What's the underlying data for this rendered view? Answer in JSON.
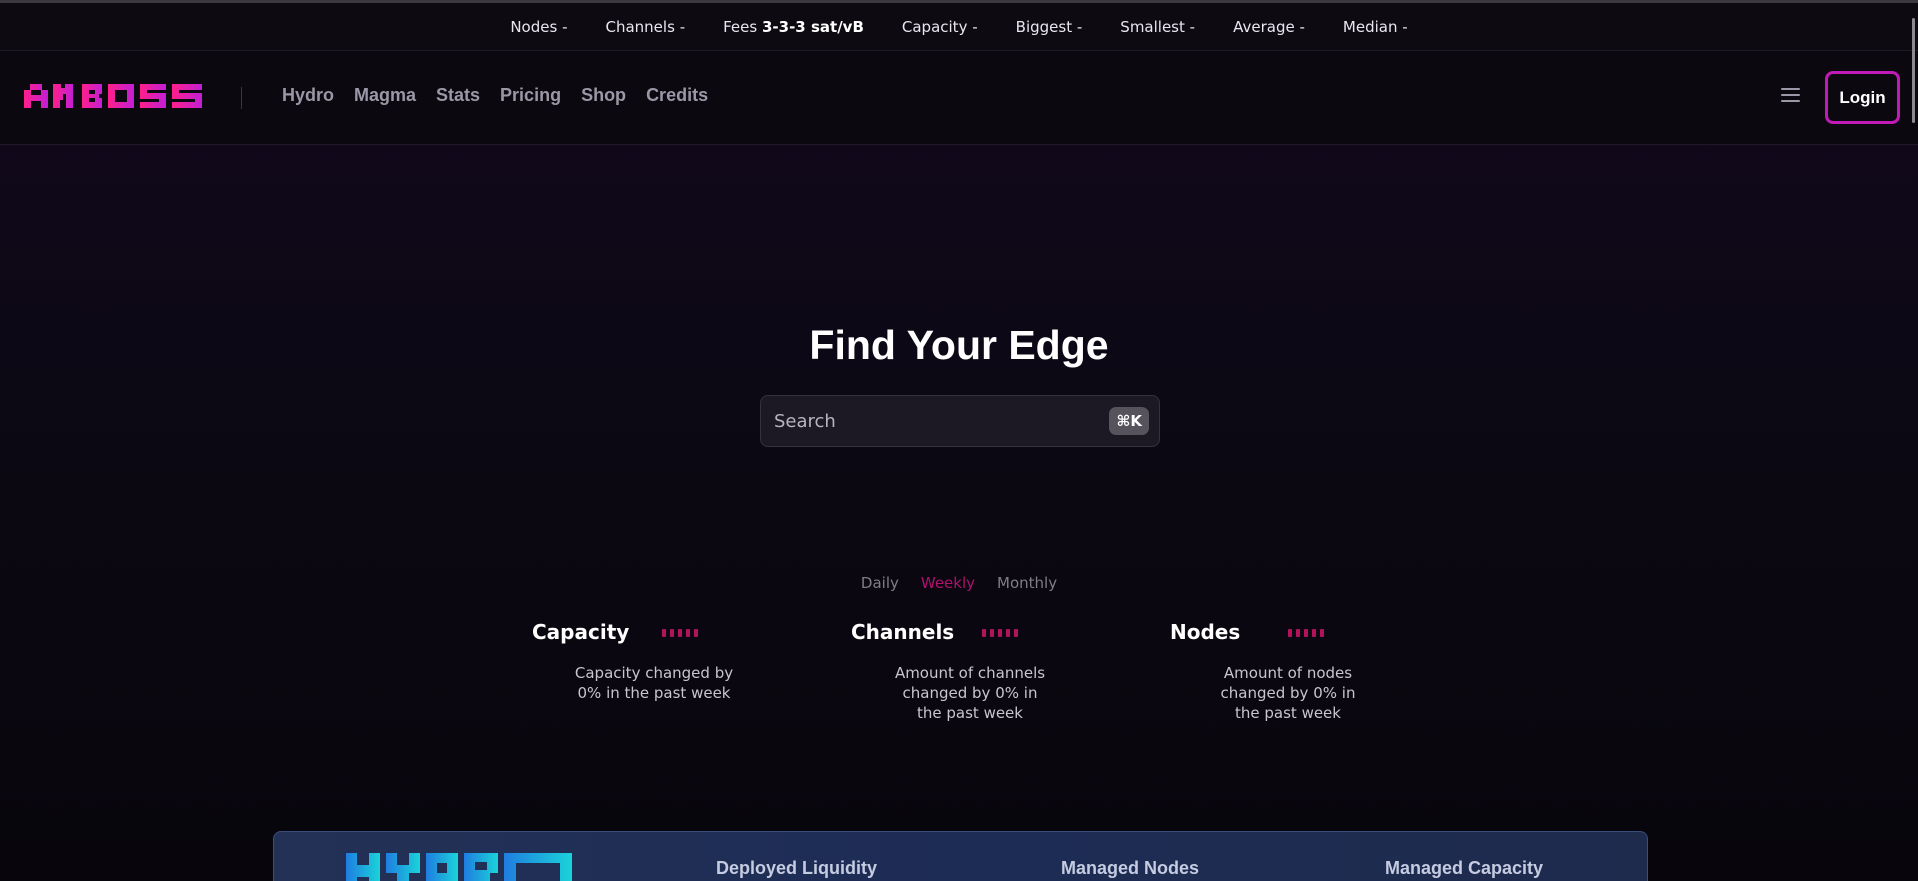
{
  "topbar": {
    "stats": [
      {
        "label": "Nodes",
        "value": "-"
      },
      {
        "label": "Channels",
        "value": "-"
      },
      {
        "label": "Fees",
        "value": "3-3-3 sat/vB"
      },
      {
        "label": "Capacity",
        "value": "-"
      },
      {
        "label": "Biggest",
        "value": "-"
      },
      {
        "label": "Smallest",
        "value": "-"
      },
      {
        "label": "Average",
        "value": "-"
      },
      {
        "label": "Median",
        "value": "-"
      }
    ]
  },
  "navbar": {
    "logo_text": "AMBOSS",
    "links": [
      "Hydro",
      "Magma",
      "Stats",
      "Pricing",
      "Shop",
      "Credits"
    ],
    "menu_icon": "hamburger-menu-icon",
    "login_label": "Login"
  },
  "hero": {
    "title": "Find Your Edge",
    "search_placeholder": "Search",
    "search_shortcut": "⌘K"
  },
  "period_tabs": {
    "items": [
      "Daily",
      "Weekly",
      "Monthly"
    ],
    "active": "Weekly"
  },
  "metrics": [
    {
      "title": "Capacity",
      "desc_lines": [
        "Capacity changed by",
        "0% in the past week"
      ]
    },
    {
      "title": "Channels",
      "desc_lines": [
        "Amount of channels",
        "changed by 0% in",
        "the past week"
      ]
    },
    {
      "title": "Nodes",
      "desc_lines": [
        "Amount of nodes",
        "changed by 0% in",
        "the past week"
      ]
    }
  ],
  "hydro_card": {
    "logo_text": "HYDRO",
    "stats": [
      "Deployed Liquidity",
      "Managed Nodes",
      "Managed Capacity"
    ]
  },
  "colors": {
    "accent_pink": "#e5137f",
    "login_border": "#c21ab8",
    "active_tab": "#b0106e",
    "hydro_blue": "#1f7de0",
    "hydro_cyan": "#1ad3d9"
  }
}
